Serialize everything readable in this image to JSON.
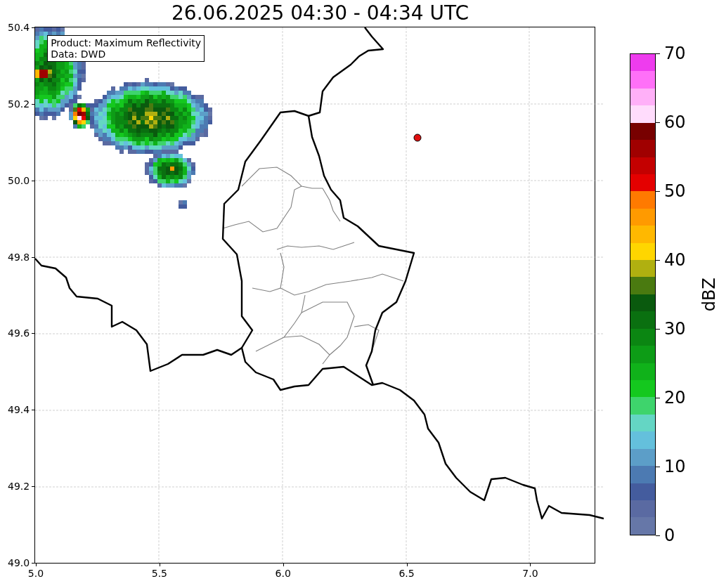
{
  "title": "26.06.2025 04:30 - 04:34 UTC",
  "info_box": [
    "Product: Maximum Reflectivity",
    "Data: DWD"
  ],
  "map": {
    "x_ticks": [
      "5.0",
      "5.5",
      "6.0",
      "6.5",
      "7.0"
    ],
    "y_ticks": [
      "50.4",
      "50.2",
      "50.0",
      "49.8",
      "49.6",
      "49.4",
      "49.2",
      "49.0"
    ]
  },
  "colorbar": {
    "label": "dBZ",
    "ticks": [
      "70",
      "60",
      "50",
      "40",
      "30",
      "20",
      "10",
      "0"
    ],
    "bands": [
      {
        "color": "#ee3cee"
      },
      {
        "color": "#ff70f8"
      },
      {
        "color": "#ffb0f8"
      },
      {
        "color": "#ffdcfc"
      },
      {
        "color": "#780000"
      },
      {
        "color": "#a00000"
      },
      {
        "color": "#c40000"
      },
      {
        "color": "#e40000"
      },
      {
        "color": "#ff7a00"
      },
      {
        "color": "#ff9a00"
      },
      {
        "color": "#ffb800"
      },
      {
        "color": "#ffd600"
      },
      {
        "color": "#b0b010"
      },
      {
        "color": "#4a7a10"
      },
      {
        "color": "#0a5a0e"
      },
      {
        "color": "#0a7010"
      },
      {
        "color": "#0b8612"
      },
      {
        "color": "#0d9c16"
      },
      {
        "color": "#10b21a"
      },
      {
        "color": "#14c81e"
      },
      {
        "color": "#3ed46c"
      },
      {
        "color": "#64d6c4"
      },
      {
        "color": "#64c0dc"
      },
      {
        "color": "#5c9ec8"
      },
      {
        "color": "#4c7ab2"
      },
      {
        "color": "#445c9e"
      },
      {
        "color": "#5a6aa2"
      },
      {
        "color": "#6677a8"
      }
    ]
  }
}
